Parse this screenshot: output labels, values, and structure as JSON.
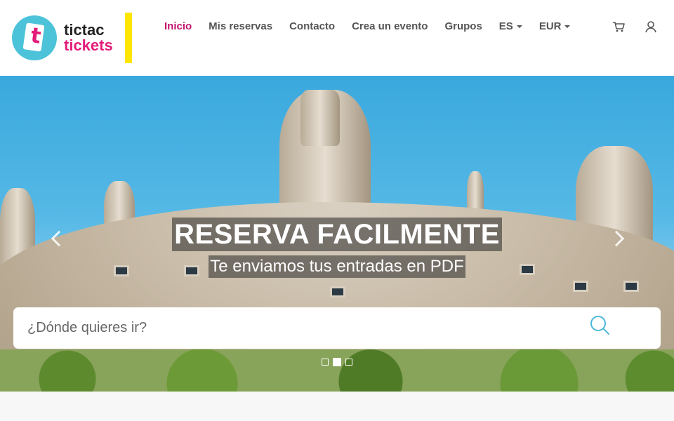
{
  "logo": {
    "line1": "tictac",
    "line2": "tickets",
    "glyph": "t"
  },
  "nav": {
    "items": [
      {
        "label": "Inicio",
        "active": true
      },
      {
        "label": "Mis reservas"
      },
      {
        "label": "Contacto"
      },
      {
        "label": "Crea un evento"
      },
      {
        "label": "Grupos"
      }
    ],
    "language": "ES",
    "currency": "EUR",
    "cart_icon": "cart-icon",
    "user_icon": "user-icon"
  },
  "hero": {
    "title": "RESERVA FACILMENTE",
    "subtitle": "Te enviamos tus entradas en PDF",
    "slide_count": 3,
    "active_slide": 2
  },
  "search": {
    "placeholder": "¿Dónde quieres ir?",
    "value": "",
    "icon": "search-icon"
  },
  "colors": {
    "brand_pink": "#c4126f",
    "brand_teal": "#4cc3d9",
    "brand_yellow": "#ffe600"
  }
}
